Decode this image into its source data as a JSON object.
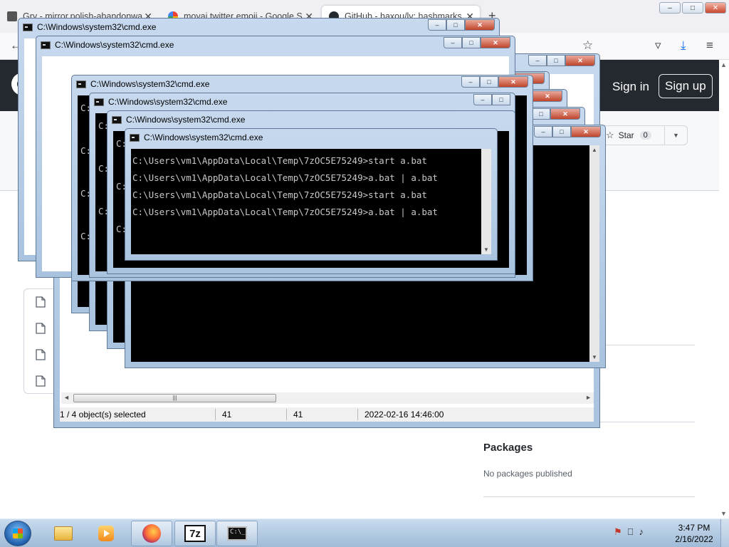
{
  "browser": {
    "tabs": [
      {
        "label": "Gry - mirror.polish-abandonwa...",
        "active": false
      },
      {
        "label": "moyai twitter emoji - Google S...",
        "active": false
      },
      {
        "label": "GitHub - haxou/lv: hashmarks",
        "active": true
      }
    ],
    "new_tab": "+",
    "window_controls": {
      "minimize": "–",
      "maximize": "□",
      "close": "✕"
    }
  },
  "github": {
    "sign_in": "Sign in",
    "sign_up": "Sign up",
    "star_label": "Star",
    "star_count": "0",
    "packages_title": "Packages",
    "packages_empty": "No packages published"
  },
  "windows": {
    "cmd_title": "C:\\Windows\\system32\\cmd.exe",
    "peek_prompt": "C:",
    "console_lines": [
      "C:\\Users\\vm1\\AppData\\Local\\Temp\\7zOC5E75249>start a.bat",
      "C:\\Users\\vm1\\AppData\\Local\\Temp\\7zOC5E75249>a.bat | a.bat",
      "C:\\Users\\vm1\\AppData\\Local\\Temp\\7zOC5E75249>start a.bat",
      "C:\\Users\\vm1\\AppData\\Local\\Temp\\7zOC5E75249>a.bat | a.bat"
    ],
    "btn_min": "–",
    "btn_max": "□",
    "btn_close": "✕"
  },
  "sevenzip": {
    "status_selected": "1 / 4 object(s) selected",
    "status_size": "41",
    "status_packed": "41",
    "status_modified": "2022-02-16 14:46:00",
    "scroll_thumb": "|||"
  },
  "taskbar": {
    "cmd_icon_text": "C:\\_",
    "sevenzip_icon_text": "7z",
    "clock_time": "3:47 PM",
    "clock_date": "2/16/2022"
  },
  "icons": {
    "back": "←",
    "pocket": "▿",
    "download": "⤓",
    "menu": "≡",
    "bookmark_star": "☆",
    "star": "☆",
    "caret": "▼",
    "tray_flag": "⚑",
    "tray_network": "⎕",
    "tray_volume": "♪",
    "scroll_up": "▲",
    "scroll_down": "▼",
    "scroll_left": "◄",
    "scroll_right": "►"
  },
  "colors": {
    "github_header": "#24292f",
    "aero_frame": "#a9c3df",
    "console_bg": "#000000",
    "close_button": "#c0452b"
  }
}
